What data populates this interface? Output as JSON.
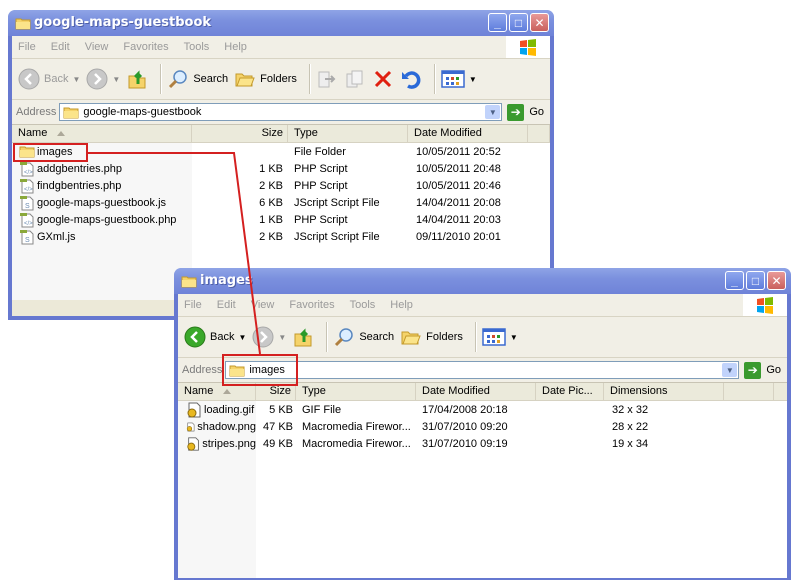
{
  "windows": {
    "parent": {
      "title": "google-maps-guestbook",
      "menu": [
        "File",
        "Edit",
        "View",
        "Favorites",
        "Tools",
        "Help"
      ],
      "toolbar": {
        "back_label": "Back",
        "search_label": "Search",
        "folders_label": "Folders"
      },
      "address": {
        "label": "Address",
        "value": "google-maps-guestbook",
        "go_label": "Go"
      },
      "columns": [
        "Name",
        "Size",
        "Type",
        "Date Modified"
      ],
      "files": [
        {
          "name": "images",
          "size": "",
          "type": "File Folder",
          "modified": "10/05/2011 20:52",
          "icon": "folder"
        },
        {
          "name": "addgbentries.php",
          "size": "1 KB",
          "type": "PHP Script",
          "modified": "10/05/2011 20:48",
          "icon": "php"
        },
        {
          "name": "findgbentries.php",
          "size": "2 KB",
          "type": "PHP Script",
          "modified": "10/05/2011 20:46",
          "icon": "php"
        },
        {
          "name": "google-maps-guestbook.js",
          "size": "6 KB",
          "type": "JScript Script File",
          "modified": "14/04/2011 20:08",
          "icon": "js"
        },
        {
          "name": "google-maps-guestbook.php",
          "size": "1 KB",
          "type": "PHP Script",
          "modified": "14/04/2011 20:03",
          "icon": "php"
        },
        {
          "name": "GXml.js",
          "size": "2 KB",
          "type": "JScript Script File",
          "modified": "09/11/2010 20:01",
          "icon": "js"
        }
      ]
    },
    "child": {
      "title": "images",
      "menu": [
        "File",
        "Edit",
        "View",
        "Favorites",
        "Tools",
        "Help"
      ],
      "toolbar": {
        "back_label": "Back",
        "search_label": "Search",
        "folders_label": "Folders"
      },
      "address": {
        "label": "Address",
        "value": "images",
        "go_label": "Go"
      },
      "columns": [
        "Name",
        "Size",
        "Type",
        "Date Modified",
        "Date Pic...",
        "Dimensions"
      ],
      "files": [
        {
          "name": "loading.gif",
          "size": "5 KB",
          "type": "GIF File",
          "modified": "17/04/2008 20:18",
          "date_picture": "",
          "dimensions": "32 x 32"
        },
        {
          "name": "shadow.png",
          "size": "47 KB",
          "type": "Macromedia Firewor...",
          "modified": "31/07/2010 09:20",
          "date_picture": "",
          "dimensions": "28 x 22"
        },
        {
          "name": "stripes.png",
          "size": "49 KB",
          "type": "Macromedia Firewor...",
          "modified": "31/07/2010 09:19",
          "date_picture": "",
          "dimensions": "19 x 34"
        }
      ]
    }
  },
  "colors": {
    "highlight": "#d42020",
    "titlebar": "#7b90de",
    "frame": "#6678d0"
  }
}
